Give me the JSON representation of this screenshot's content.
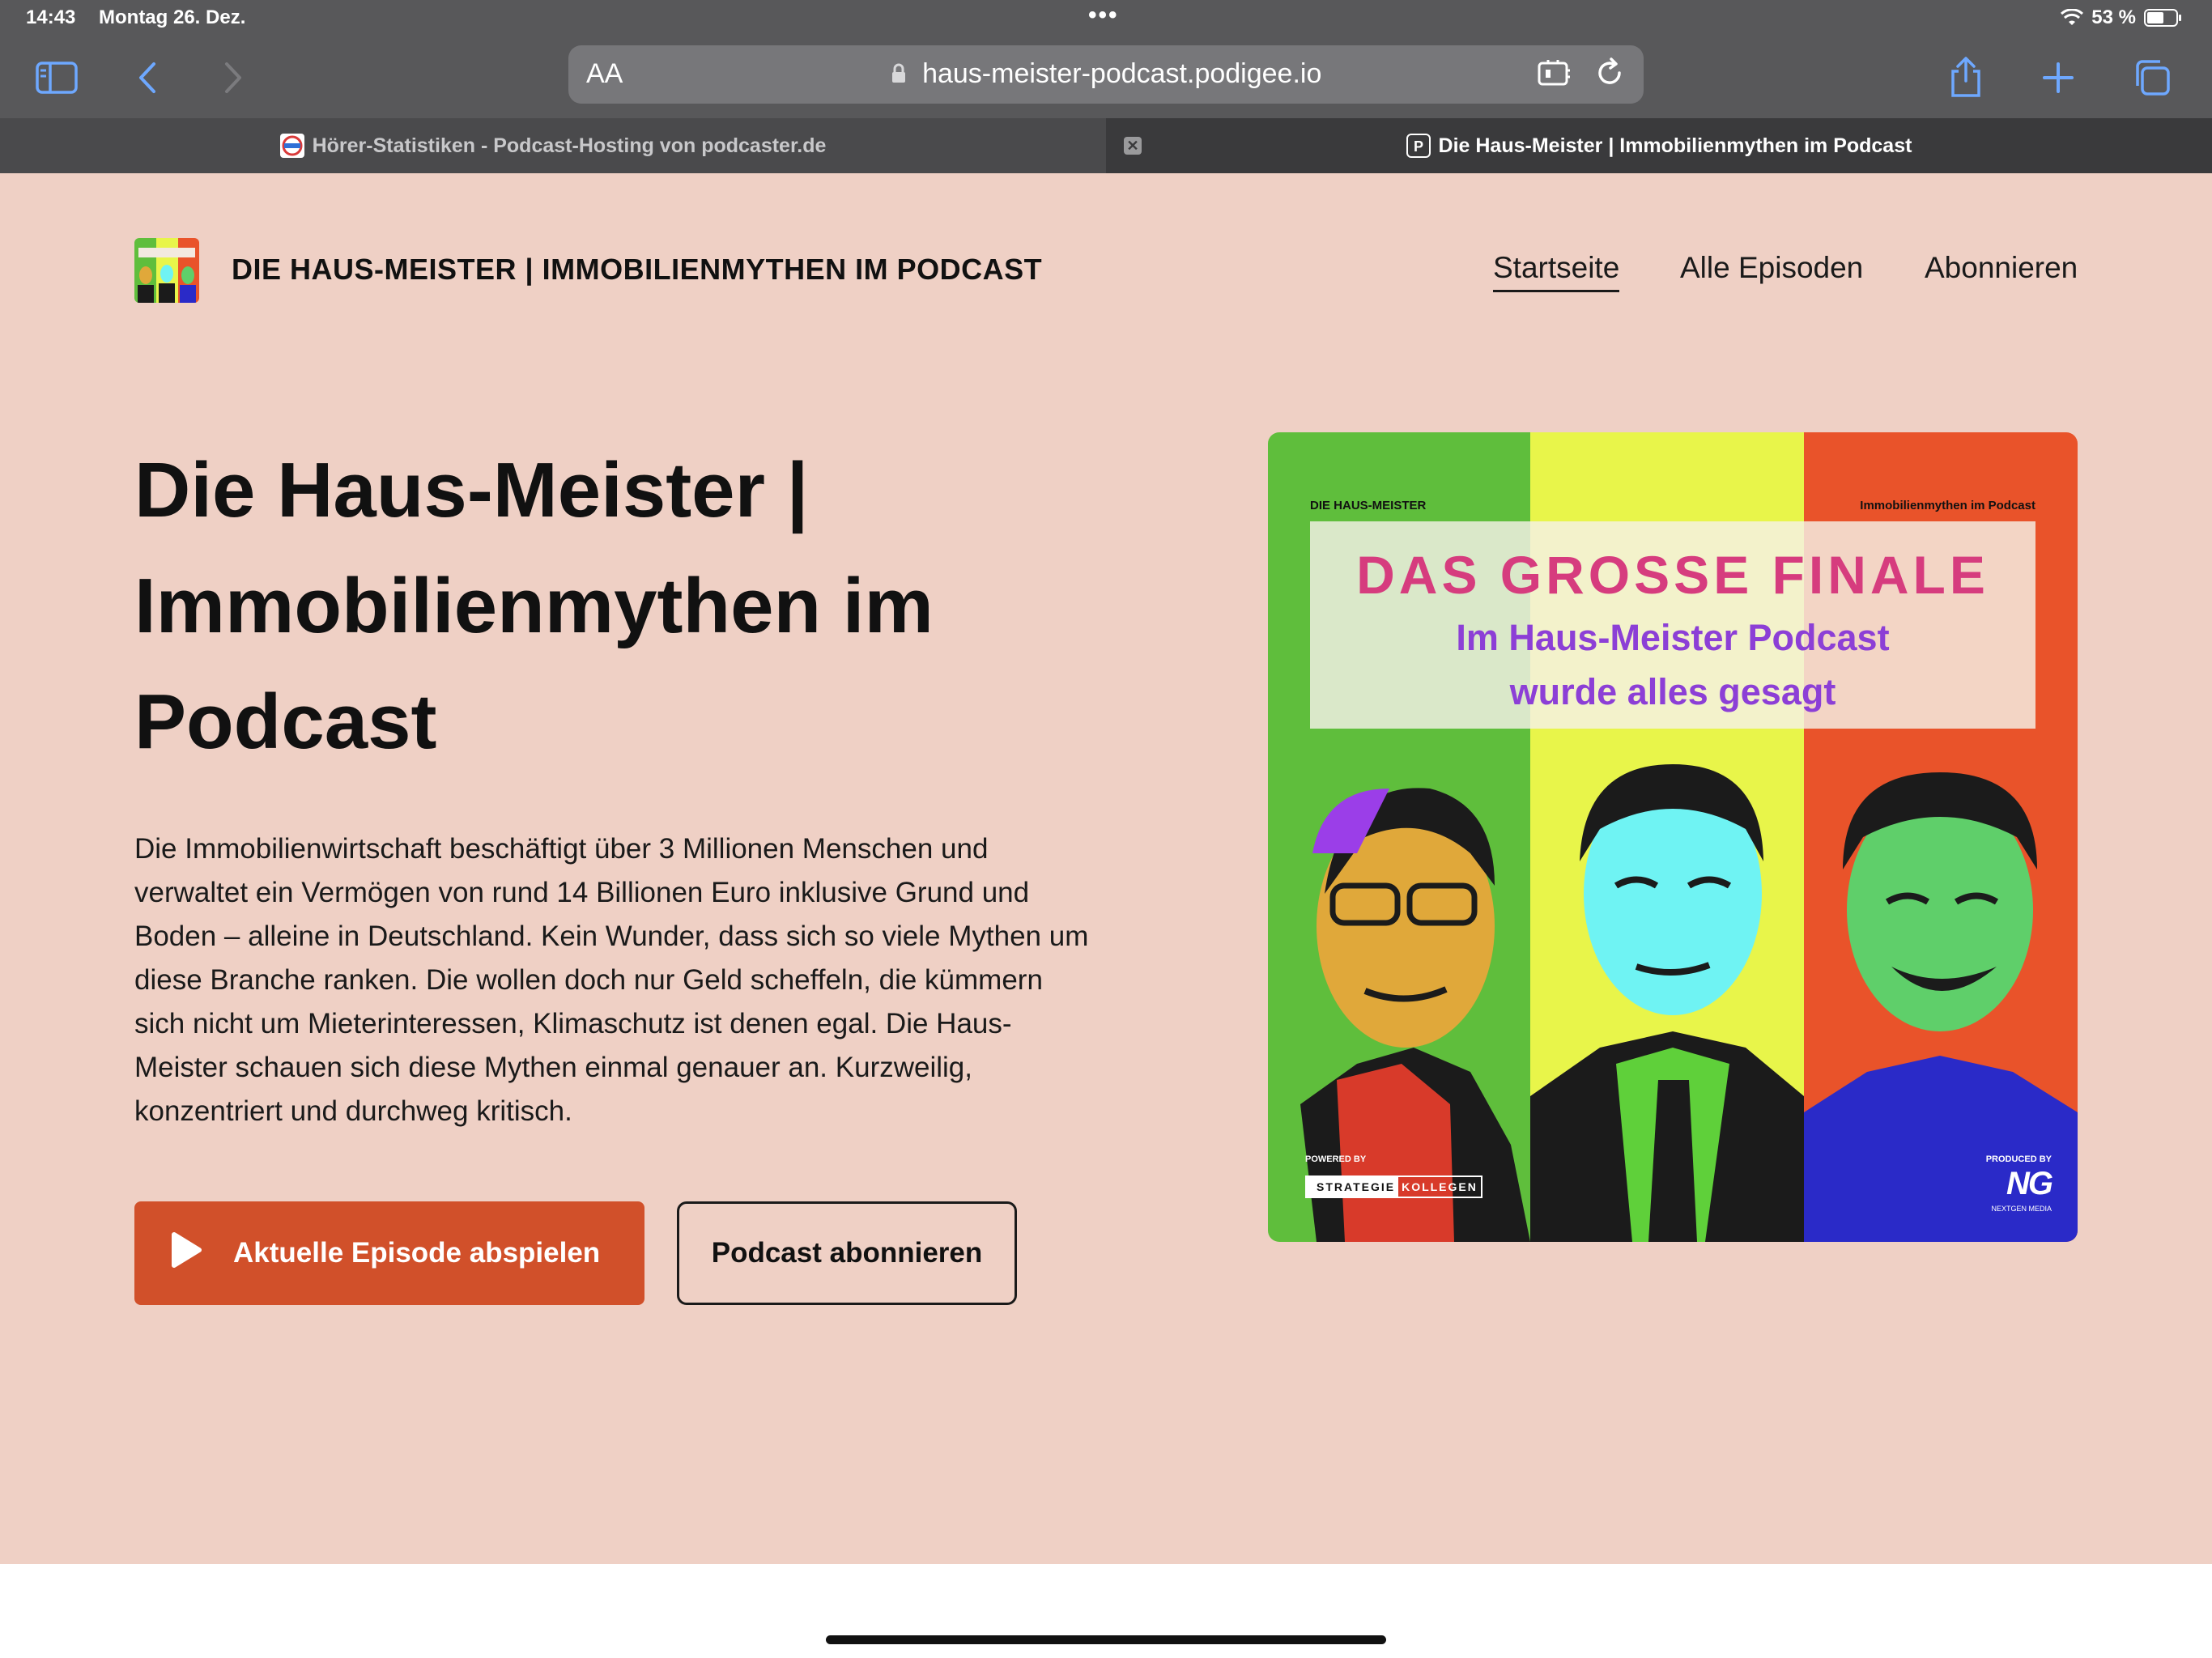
{
  "status_bar": {
    "time": "14:43",
    "date": "Montag 26. Dez.",
    "battery": "53 %"
  },
  "browser": {
    "text_size_label": "AA",
    "url": "haus-meister-podcast.podigee.io",
    "tabs": [
      {
        "title": "Hörer-Statistiken - Podcast-Hosting von podcaster.de"
      },
      {
        "title": "Die Haus-Meister | Immobilienmythen im Podcast"
      }
    ]
  },
  "site": {
    "title": "DIE HAUS-MEISTER | IMMOBILIENMYTHEN IM PODCAST",
    "nav": [
      "Startseite",
      "Alle Episoden",
      "Abonnieren"
    ]
  },
  "hero": {
    "title": "Die Haus-Meister | Immobilienmythen im Podcast",
    "description": "Die Immobilienwirtschaft beschäftigt über 3 Millionen Menschen und verwaltet ein Vermögen von rund 14 Billionen Euro inklusive Grund und Boden – alleine in Deutschland. Kein Wunder, dass sich so viele Mythen um diese Branche ranken. Die wollen doch nur Geld scheffeln, die kümmern sich nicht um Mieterinteressen, Klimaschutz ist denen egal. Die Haus-Meister schauen sich diese Mythen einmal genauer an. Kurzweilig, konzentriert und durchweg kritisch.",
    "play_button": "Aktuelle Episode abspielen",
    "subscribe_button": "Podcast abonnieren"
  },
  "cover": {
    "top_left": "DIE HAUS-MEISTER",
    "top_right": "Immobilienmythen im Podcast",
    "headline": "DAS GROSSE FINALE",
    "subline_1": "Im Haus-Meister Podcast",
    "subline_2": "wurde alles gesagt",
    "powered_by": "POWERED BY",
    "sponsor_a": "STRATEGIE",
    "sponsor_b": "KOLLEGEN",
    "produced_by": "PRODUCED BY",
    "producer_logo": "NG",
    "producer_name": "NEXTGEN MEDIA"
  },
  "colors": {
    "page_bg": "#efd0c5",
    "accent": "#d1502a",
    "cover_green": "#5fbe3c",
    "cover_yellow": "#e8f54a",
    "cover_red": "#e9532a",
    "headline_pink": "#d63c7e",
    "subline_purple": "#8c3fd6"
  }
}
